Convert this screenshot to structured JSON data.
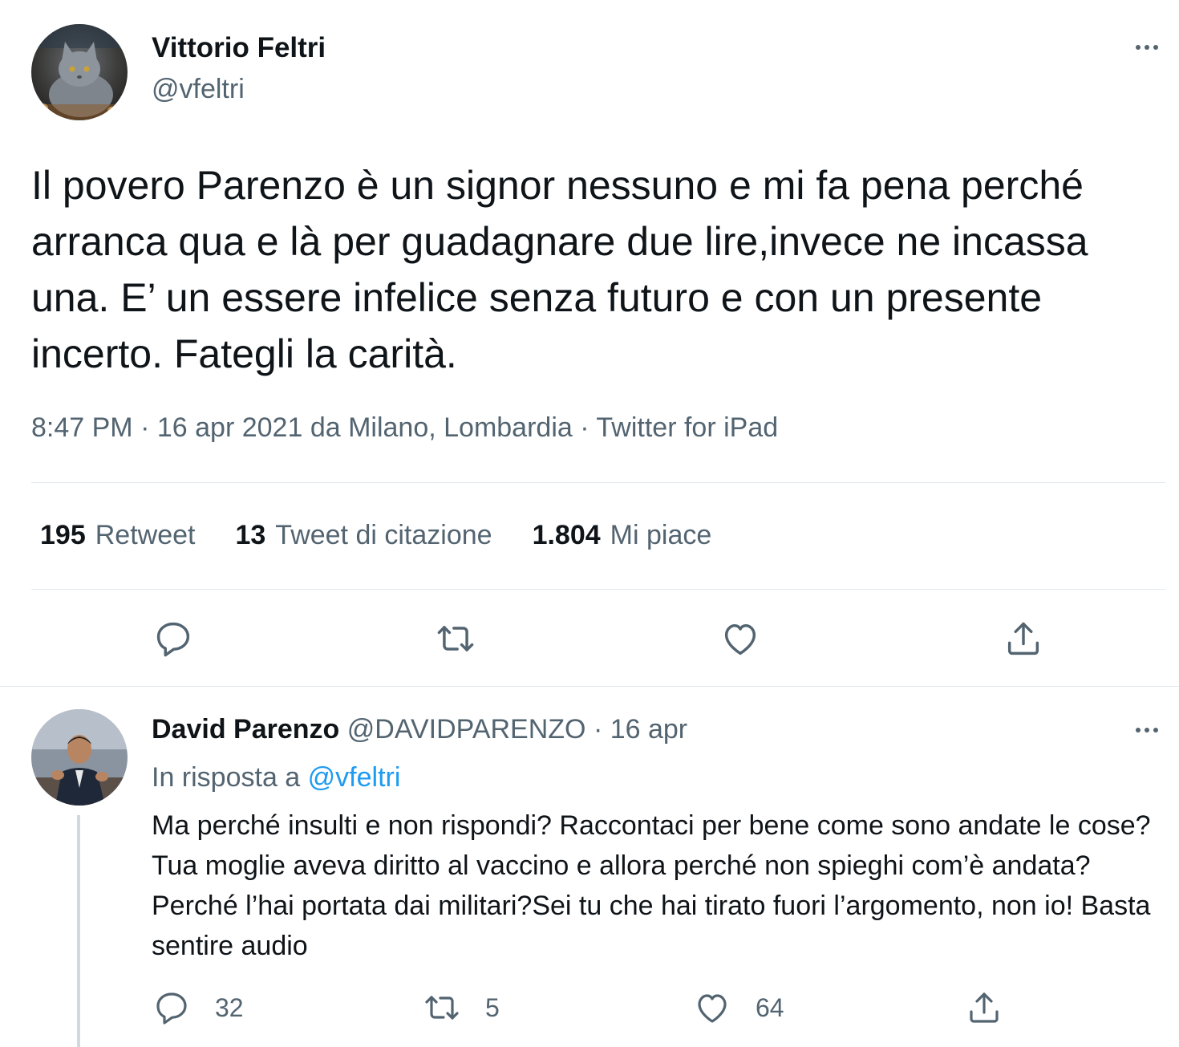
{
  "main_tweet": {
    "author_name": "Vittorio Feltri",
    "author_handle": "@vfeltri",
    "avatar_icon": "cat-avatar",
    "text": "Il povero Parenzo è un signor nessuno e mi fa pena perché arranca qua e là per guadagnare due lire,invece ne incassa una. E’ un essere infelice senza futuro e con un presente incerto. Fategli la carità.",
    "time": "8:47 PM",
    "date": "16 apr 2021",
    "location": "da Milano, Lombardia",
    "source": "Twitter for iPad",
    "separator": "·",
    "stats": {
      "retweets_count": "195",
      "retweets_label": "Retweet",
      "quotes_count": "13",
      "quotes_label": "Tweet di citazione",
      "likes_count": "1.804",
      "likes_label": "Mi piace"
    },
    "actions": [
      "reply-icon",
      "retweet-icon",
      "like-icon",
      "share-icon"
    ]
  },
  "reply": {
    "author_name": "David Parenzo",
    "author_handle": "@DAVIDPARENZO",
    "date": "· 16 apr",
    "in_reply_label": "In risposta a",
    "in_reply_to": "@vfeltri",
    "text": "Ma perché insulti e non rispondi? Raccontaci per bene come sono andate le cose?Tua moglie aveva diritto al vaccino e allora perché non spieghi com’è andata?Perché l’hai portata dai militari?Sei tu che hai tirato fuori l’argomento, non io! Basta sentire audio",
    "reply_count": "32",
    "retweet_count": "5",
    "like_count": "64"
  },
  "colors": {
    "text_primary": "#0f1419",
    "text_secondary": "#536471",
    "accent": "#1d9bf0",
    "divider": "#e1e8ed"
  }
}
